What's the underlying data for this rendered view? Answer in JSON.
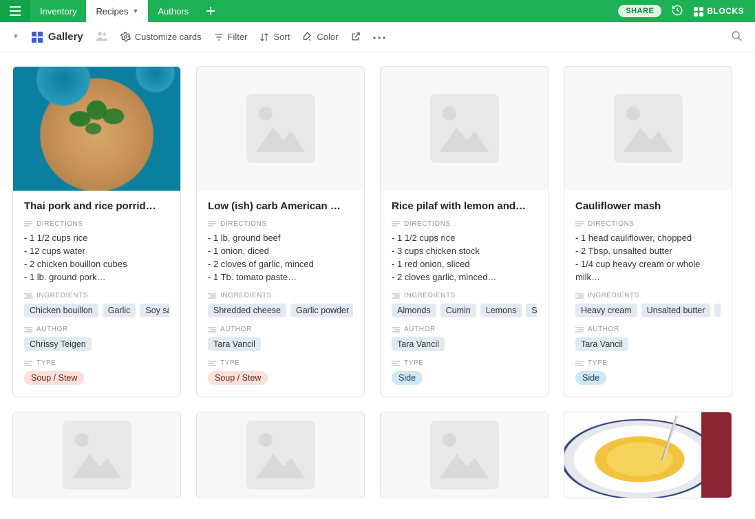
{
  "topbar": {
    "tabs": [
      "Inventory",
      "Recipes",
      "Authors"
    ],
    "active_index": 1,
    "share_label": "SHARE",
    "blocks_label": "BLOCKS"
  },
  "viewbar": {
    "view_name": "Gallery",
    "customize": "Customize cards",
    "filter": "Filter",
    "sort": "Sort",
    "color": "Color"
  },
  "field_labels": {
    "directions": "DIRECTIONS",
    "ingredients": "INGREDIENTS",
    "author": "AUTHOR",
    "type": "TYPE"
  },
  "cards": [
    {
      "title": "Thai pork and rice porrid…",
      "image": "photo1",
      "directions": "- 1 1/2 cups rice\n- 12 cups water\n- 2 chicken bouillon cubes\n- 1 lb. ground pork…",
      "ingredients": [
        "Chicken bouillon",
        "Garlic",
        "Soy sau"
      ],
      "author": "Chrissy Teigen",
      "type": "Soup / Stew",
      "type_color": "red"
    },
    {
      "title": "Low (ish) carb American …",
      "image": "",
      "directions": "- 1 lb. ground beef\n- 1 onion, diced\n- 2 cloves of garlic, minced\n- 1 Tb. tomato paste…",
      "ingredients": [
        "Shredded cheese",
        "Garlic powder"
      ],
      "author": "Tara Vancil",
      "type": "Soup / Stew",
      "type_color": "red"
    },
    {
      "title": "Rice pilaf with lemon and…",
      "image": "",
      "directions": "- 1 1/2 cups rice\n- 3 cups chicken stock\n- 1 red onion, sliced\n- 2 cloves garlic, minced…",
      "ingredients": [
        "Almonds",
        "Cumin",
        "Lemons",
        "Spina"
      ],
      "author": "Tara Vancil",
      "type": "Side",
      "type_color": "blue"
    },
    {
      "title": "Cauliflower mash",
      "image": "",
      "directions": "- 1 head cauliflower, chopped\n- 2 Tbsp. unsalted butter\n- 1/4 cup heavy cream or whole milk…",
      "ingredients": [
        "Heavy cream",
        "Unsalted butter",
        "C"
      ],
      "author": "Tara Vancil",
      "type": "Side",
      "type_color": "blue"
    }
  ],
  "cards_row2": [
    {
      "image": ""
    },
    {
      "image": ""
    },
    {
      "image": ""
    },
    {
      "image": "photo2"
    }
  ]
}
